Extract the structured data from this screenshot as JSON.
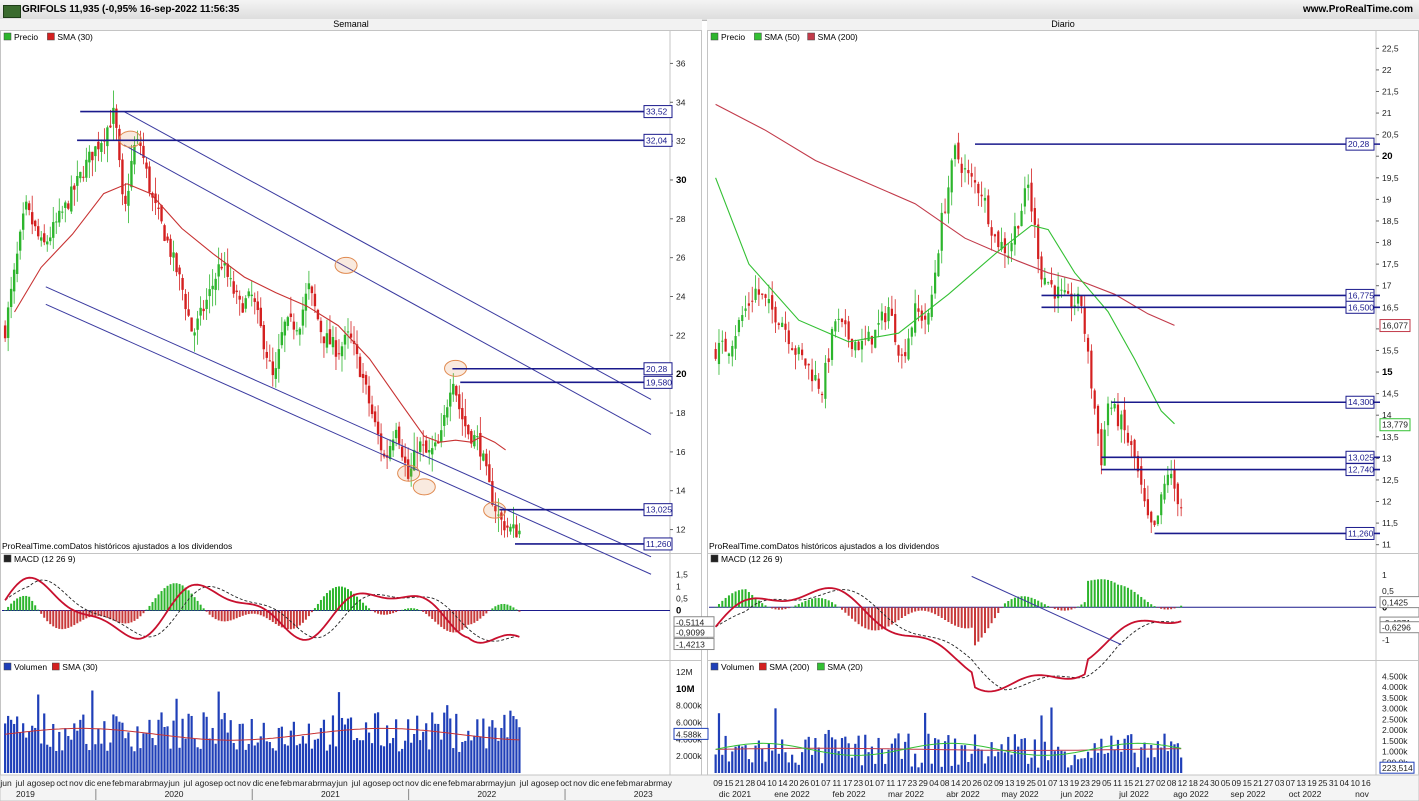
{
  "window": {
    "title": "GRIFOLS 11,935 (-0,95% 16-sep-2022 11:56:35",
    "site": "www.ProRealTime.com"
  },
  "panels": {
    "weekly_title": "Semanal",
    "daily_title": "Diario"
  },
  "legends": {
    "weekly_price": [
      "Precio",
      "SMA (30)"
    ],
    "daily_price": [
      "Precio",
      "SMA (50)",
      "SMA (200)"
    ],
    "macd": "MACD (12 26 9)",
    "weekly_volume": [
      "Volumen",
      "SMA (30)"
    ],
    "daily_volume": [
      "Volumen",
      "SMA (200)",
      "SMA (20)"
    ],
    "source_note": "ProRealTime.comDatos históricos ajustados a los dividendos"
  },
  "colors": {
    "bull": "#2db52d",
    "bear": "#d42020",
    "sma30": "#c83232",
    "sma50": "#33c033",
    "sma200": "#c23a4a",
    "levels": "#1a1a8c",
    "channel": "#3a3aa0",
    "volume": "#1f3fb8",
    "macd_line": "#c8102e",
    "macd_hist_pos": "#2db52d",
    "macd_hist_neg": "#c83a3a",
    "highlight_oval": "#e08a50"
  },
  "chart_data": [
    {
      "id": "weekly_price",
      "type": "candlestick",
      "title": "Semanal",
      "ylim": [
        11,
        37
      ],
      "y_ticks": [
        "36",
        "34",
        "32",
        "30",
        "28",
        "26",
        "24",
        "22",
        "20",
        "18",
        "16",
        "14",
        "12"
      ],
      "x_ticks": [
        "jun",
        "jul",
        "ago",
        "sep",
        "oct",
        "nov",
        "dic",
        "ene",
        "feb",
        "mar",
        "abr",
        "may",
        "jun",
        "jul",
        "ago",
        "sep",
        "oct",
        "nov",
        "dic",
        "ene",
        "feb",
        "mar",
        "abr",
        "may",
        "jun",
        "jul",
        "ago",
        "sep",
        "oct",
        "nov",
        "dic",
        "ene",
        "feb",
        "mar",
        "abr",
        "may",
        "jun",
        "jul",
        "ago",
        "sep",
        "oct",
        "nov",
        "dic",
        "ene",
        "feb",
        "mar",
        "abr",
        "may"
      ],
      "x_years": [
        "2019",
        "2020",
        "2021",
        "2022",
        "2023"
      ],
      "close_path": [
        [
          2019.42,
          22.3
        ],
        [
          2019.55,
          28.6
        ],
        [
          2019.66,
          26.5
        ],
        [
          2019.8,
          28.5
        ],
        [
          2019.95,
          31.0
        ],
        [
          2020.05,
          32.3
        ],
        [
          2020.12,
          33.5
        ],
        [
          2020.18,
          28.0
        ],
        [
          2020.24,
          31.6
        ],
        [
          2020.28,
          32.0
        ],
        [
          2020.36,
          29.0
        ],
        [
          2020.45,
          27.0
        ],
        [
          2020.55,
          24.5
        ],
        [
          2020.62,
          22.0
        ],
        [
          2020.72,
          24.0
        ],
        [
          2020.8,
          25.8
        ],
        [
          2020.92,
          23.5
        ],
        [
          2021.0,
          24.0
        ],
        [
          2021.08,
          21.5
        ],
        [
          2021.14,
          19.5
        ],
        [
          2021.2,
          22.5
        ],
        [
          2021.3,
          22.6
        ],
        [
          2021.36,
          24.5
        ],
        [
          2021.45,
          22.0
        ],
        [
          2021.55,
          21.2
        ],
        [
          2021.62,
          22.0
        ],
        [
          2021.7,
          20.0
        ],
        [
          2021.78,
          17.5
        ],
        [
          2021.85,
          15.5
        ],
        [
          2021.92,
          17.5
        ],
        [
          2022.0,
          14.5
        ],
        [
          2022.06,
          16.5
        ],
        [
          2022.12,
          15.8
        ],
        [
          2022.2,
          16.4
        ],
        [
          2022.28,
          20.1
        ],
        [
          2022.33,
          18.0
        ],
        [
          2022.38,
          17.0
        ],
        [
          2022.45,
          16.5
        ],
        [
          2022.52,
          14.0
        ],
        [
          2022.58,
          12.5
        ],
        [
          2022.65,
          12.0
        ],
        [
          2022.71,
          11.9
        ]
      ],
      "sma30_path": [
        [
          2019.48,
          23.2
        ],
        [
          2019.65,
          25.5
        ],
        [
          2019.85,
          27.2
        ],
        [
          2020.05,
          29.3
        ],
        [
          2020.2,
          29.8
        ],
        [
          2020.35,
          29.3
        ],
        [
          2020.55,
          27.5
        ],
        [
          2020.75,
          26.2
        ],
        [
          2020.95,
          25.0
        ],
        [
          2021.15,
          24.2
        ],
        [
          2021.35,
          23.5
        ],
        [
          2021.55,
          22.5
        ],
        [
          2021.75,
          20.8
        ],
        [
          2021.95,
          18.5
        ],
        [
          2022.1,
          16.8
        ],
        [
          2022.2,
          16.5
        ],
        [
          2022.3,
          16.6
        ],
        [
          2022.4,
          16.5
        ],
        [
          2022.47,
          16.8
        ],
        [
          2022.55,
          16.5
        ],
        [
          2022.62,
          16.1
        ]
      ],
      "levels": [
        {
          "value": 33.52,
          "label": "33,52",
          "from": 2019.9
        },
        {
          "value": 32.04,
          "label": "32,04",
          "from": 2019.88
        },
        {
          "value": 20.28,
          "label": "20,28",
          "from": 2022.28
        },
        {
          "value": 19.58,
          "label": "19,580",
          "from": 2022.33
        },
        {
          "value": 13.025,
          "label": "13,025",
          "from": 2022.58
        },
        {
          "value": 11.26,
          "label": "11,260",
          "from": 2022.68
        }
      ],
      "channel_lines": [
        {
          "from": [
            2020.18,
            33.52
          ],
          "to": [
            2023.55,
            18.7
          ]
        },
        {
          "from": [
            2020.18,
            31.8
          ],
          "to": [
            2023.55,
            16.9
          ]
        },
        {
          "from": [
            2019.68,
            24.5
          ],
          "to": [
            2023.55,
            10.6
          ]
        },
        {
          "from": [
            2019.68,
            23.6
          ],
          "to": [
            2023.55,
            9.7
          ]
        }
      ],
      "markers": [
        [
          2020.22,
          32.1
        ],
        [
          2021.6,
          25.6
        ],
        [
          2022.3,
          20.3
        ],
        [
          2022.0,
          14.9
        ],
        [
          2022.1,
          14.2
        ],
        [
          2022.55,
          13.0
        ]
      ]
    },
    {
      "id": "daily_price",
      "type": "candlestick",
      "title": "Diario",
      "ylim": [
        10.9,
        22.6
      ],
      "y_ticks": [
        "22,5",
        "22",
        "21,5",
        "21",
        "20,5",
        "20",
        "19,5",
        "19",
        "18,5",
        "18",
        "17,5",
        "17",
        "16,5",
        "16",
        "15,5",
        "15",
        "14,5",
        "14",
        "13,5",
        "13",
        "12,5",
        "12",
        "11,5",
        "11"
      ],
      "x_ticks": [
        "09",
        "15",
        "21",
        "28",
        "04",
        "10",
        "14",
        "20",
        "26",
        "01",
        "07",
        "11",
        "17",
        "23",
        "01",
        "07",
        "11",
        "17",
        "23",
        "29",
        "04",
        "08",
        "14",
        "20",
        "26",
        "02",
        "09",
        "13",
        "19",
        "25",
        "01",
        "07",
        "13",
        "19",
        "23",
        "29",
        "05",
        "11",
        "15",
        "21",
        "27",
        "02",
        "08",
        "12",
        "18",
        "24",
        "30",
        "05",
        "09",
        "15",
        "21",
        "27",
        "03",
        "07",
        "13",
        "19",
        "25",
        "31",
        "04",
        "10",
        "16"
      ],
      "x_months": [
        "dic 2021",
        "ene 2022",
        "feb 2022",
        "mar 2022",
        "abr 2022",
        "may 2022",
        "jun 2022",
        "jul 2022",
        "ago 2022",
        "sep 2022",
        "oct 2022",
        "nov"
      ],
      "close_path": [
        [
          0,
          15.5
        ],
        [
          4,
          15.6
        ],
        [
          8,
          16.3
        ],
        [
          12,
          16.9
        ],
        [
          16,
          16.5
        ],
        [
          20,
          16.2
        ],
        [
          24,
          15.5
        ],
        [
          28,
          15.1
        ],
        [
          32,
          14.6
        ],
        [
          36,
          16.2
        ],
        [
          40,
          15.8
        ],
        [
          44,
          15.6
        ],
        [
          48,
          15.9
        ],
        [
          52,
          16.5
        ],
        [
          56,
          15.3
        ],
        [
          60,
          16.4
        ],
        [
          64,
          16.2
        ],
        [
          68,
          18.5
        ],
        [
          72,
          20.1
        ],
        [
          76,
          19.5
        ],
        [
          80,
          19.2
        ],
        [
          84,
          18.1
        ],
        [
          88,
          17.8
        ],
        [
          92,
          18.8
        ],
        [
          94,
          19.3
        ],
        [
          98,
          17.3
        ],
        [
          102,
          16.9
        ],
        [
          106,
          16.6
        ],
        [
          110,
          16.6
        ],
        [
          112,
          15.3
        ],
        [
          116,
          13.0
        ],
        [
          118,
          14.3
        ],
        [
          122,
          13.8
        ],
        [
          126,
          13.0
        ],
        [
          130,
          11.5
        ],
        [
          132,
          11.3
        ],
        [
          134,
          12.0
        ],
        [
          136,
          12.7
        ],
        [
          140,
          11.9
        ]
      ],
      "sma50_path": [
        [
          0,
          19.5
        ],
        [
          10,
          17.5
        ],
        [
          25,
          16.2
        ],
        [
          40,
          15.7
        ],
        [
          55,
          15.9
        ],
        [
          70,
          16.8
        ],
        [
          85,
          17.8
        ],
        [
          95,
          18.4
        ],
        [
          100,
          18.3
        ],
        [
          108,
          17.3
        ],
        [
          118,
          16.4
        ],
        [
          126,
          15.3
        ],
        [
          134,
          14.1
        ],
        [
          138,
          13.8
        ]
      ],
      "sma200_path": [
        [
          0,
          21.2
        ],
        [
          15,
          20.6
        ],
        [
          30,
          19.9
        ],
        [
          45,
          19.4
        ],
        [
          60,
          18.9
        ],
        [
          75,
          18.1
        ],
        [
          90,
          17.6
        ],
        [
          100,
          17.3
        ],
        [
          110,
          17.1
        ],
        [
          120,
          16.8
        ],
        [
          130,
          16.35
        ],
        [
          138,
          16.08
        ]
      ],
      "levels": [
        {
          "value": 20.28,
          "label": "20,28",
          "from": 78
        },
        {
          "value": 16.775,
          "label": "16,775",
          "from": 98
        },
        {
          "value": 16.5,
          "label": "16,500",
          "from": 98
        },
        {
          "value": 14.3,
          "label": "14,300",
          "from": 119
        },
        {
          "value": 13.025,
          "label": "13,025",
          "from": 116
        },
        {
          "value": 12.74,
          "label": "12,740",
          "from": 116
        },
        {
          "value": 11.26,
          "label": "11,260",
          "from": 132
        }
      ],
      "last_values": [
        {
          "value": 16.077,
          "label": "16,077",
          "color": "#c23a4a"
        },
        {
          "value": 13.779,
          "label": "13,779",
          "color": "#33c033"
        }
      ]
    },
    {
      "id": "weekly_macd",
      "type": "line",
      "title": "MACD (12 26 9)",
      "ylim": [
        -1.9,
        1.9
      ],
      "y_ticks": [
        "1,5",
        "1",
        "0,5",
        "0",
        "-0,5",
        "-1"
      ],
      "last_values": [
        {
          "value": -0.5114,
          "label": "-0,5114"
        },
        {
          "value": -0.9099,
          "label": "-0,9099"
        },
        {
          "value": -1.4213,
          "label": "-1,4213"
        }
      ]
    },
    {
      "id": "daily_macd",
      "type": "line",
      "title": "MACD (12 26 9)",
      "ylim": [
        -1.5,
        1.3
      ],
      "y_ticks": [
        "1",
        "0,5",
        "0",
        "-0,5",
        "-1"
      ],
      "last_values": [
        {
          "value": 0.1425,
          "label": "0,1425"
        },
        {
          "value": -0.4871,
          "label": "-0,4871"
        },
        {
          "value": -0.6296,
          "label": "-0,6296"
        }
      ]
    },
    {
      "id": "weekly_volume",
      "type": "bar",
      "title": "Volumen",
      "ylim": [
        0,
        12000
      ],
      "y_ticks": [
        "12M",
        "10M",
        "8.000k",
        "6.000k",
        "4.000k",
        "2.000k"
      ],
      "last_value": {
        "value": 4588,
        "label": "4.588k"
      }
    },
    {
      "id": "daily_volume",
      "type": "bar",
      "title": "Volumen",
      "ylim": [
        0,
        4700
      ],
      "y_ticks": [
        "4.500k",
        "4.000k",
        "3.500k",
        "3.000k",
        "2.500k",
        "2.000k",
        "1.500k",
        "1.000k",
        "500,0k"
      ],
      "last_value": {
        "value": 223.5,
        "label": "223,514"
      }
    }
  ]
}
